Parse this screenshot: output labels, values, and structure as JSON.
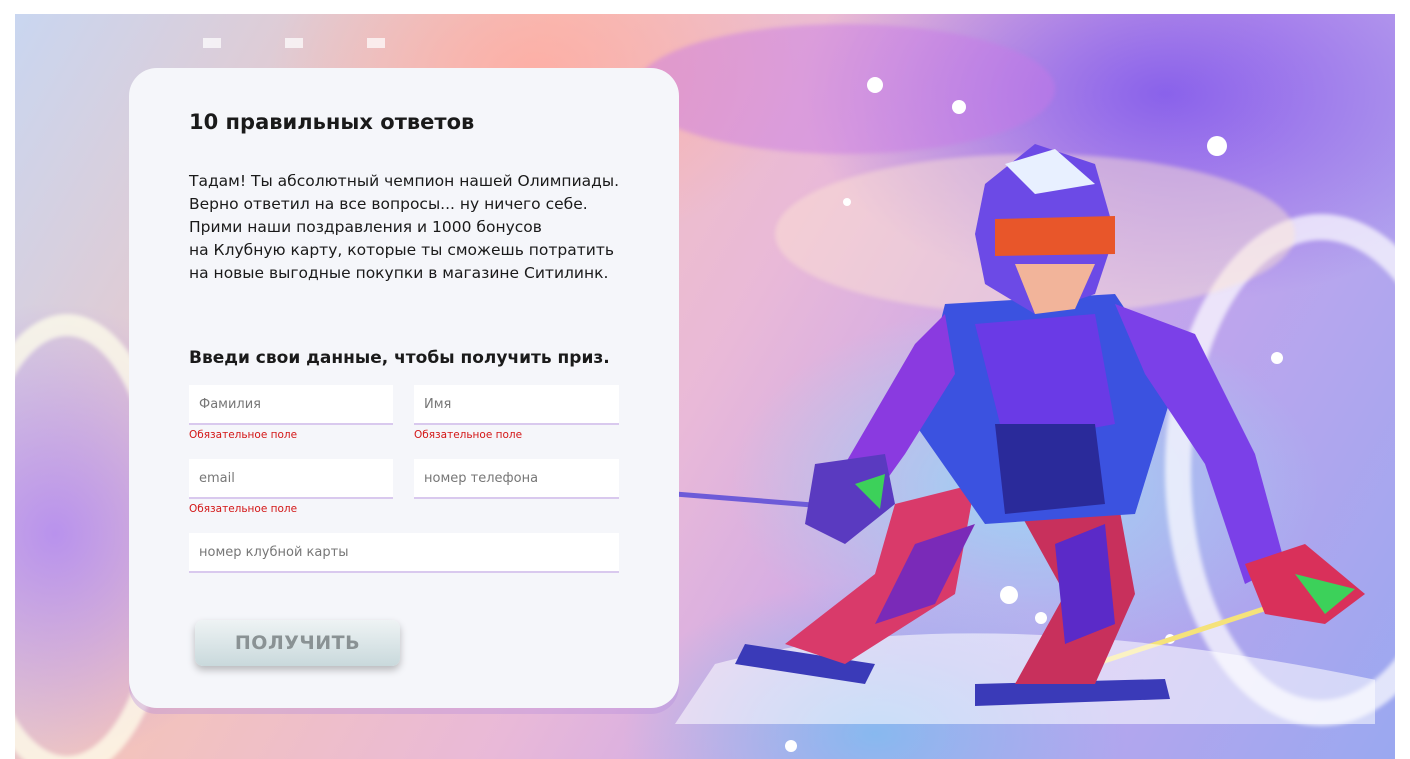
{
  "card": {
    "title": "10 правильных ответов",
    "paragraph_lines": [
      "Тадам! Ты абсолютный чемпион нашей Олимпиады.",
      "Верно ответил на все вопросы... ну ничего себе.",
      "Прими наши поздравления и 1000 бонусов",
      "на Клубную карту, которые ты сможешь потратить",
      "на новые выгодные покупки в магазине Ситилинк."
    ],
    "form_heading": "Введи свои данные, чтобы получить приз."
  },
  "form": {
    "last_name_placeholder": "Фамилия",
    "first_name_placeholder": "Имя",
    "email_placeholder": "email",
    "phone_placeholder": "номер телефона",
    "club_card_placeholder": "номер клубной карты",
    "required_error": "Обязательное поле",
    "submit_label": "ПОЛУЧИТЬ"
  },
  "illustration": {
    "subject": "skier",
    "colors": {
      "accent_purple": "#8b5cf6",
      "error_red": "#d31616",
      "card_bg": "#f5f6fa"
    }
  }
}
